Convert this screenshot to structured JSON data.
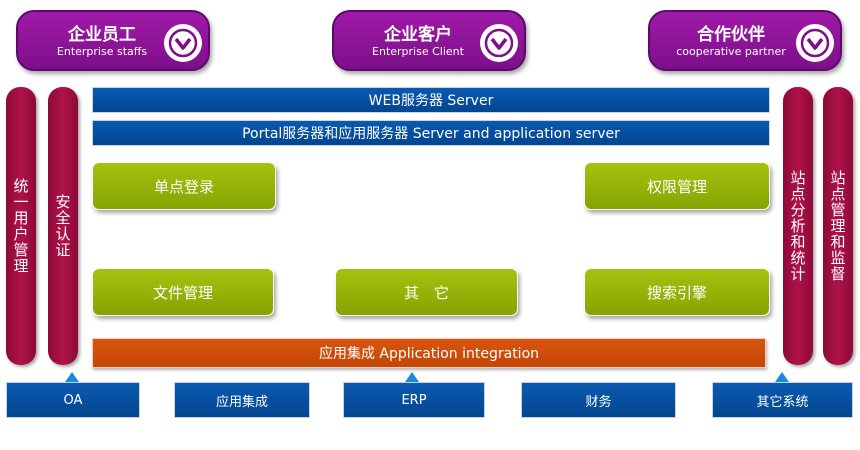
{
  "roles": [
    {
      "cn": "企业员工",
      "en": "Enterprise staffs",
      "icon": "chevron-down-icon"
    },
    {
      "cn": "企业客户",
      "en": "Enterprise Client",
      "icon": "chevron-down-icon"
    },
    {
      "cn": "合作伙伴",
      "en": "cooperative partner",
      "icon": "chevron-down-icon"
    }
  ],
  "left_pillars": [
    {
      "label": "统一用户管理"
    },
    {
      "label": "安全认证"
    }
  ],
  "right_pillars": [
    {
      "label": "站点分析和统计"
    },
    {
      "label": "站点管理和监督"
    }
  ],
  "server_bars": {
    "web": "WEB服务器 Server",
    "portal": "Portal服务器和应用服务器 Server and application server"
  },
  "modules": {
    "sso": "单点登录",
    "permission": "权限管理",
    "file": "文件管理",
    "other": "其　它",
    "search": "搜索引擎"
  },
  "integration_bar": "应用集成 Application integration",
  "systems": [
    {
      "label": "OA"
    },
    {
      "label": "应用集成"
    },
    {
      "label": "ERP"
    },
    {
      "label": "财务"
    },
    {
      "label": "其它系统"
    }
  ],
  "colors": {
    "role_purple": "#8e139b",
    "pillar_crimson": "#a0103f",
    "server_blue": "#03509f",
    "module_green": "#95b209",
    "integration_orange": "#d04c0a",
    "connector_blue": "#1a8ae0"
  }
}
